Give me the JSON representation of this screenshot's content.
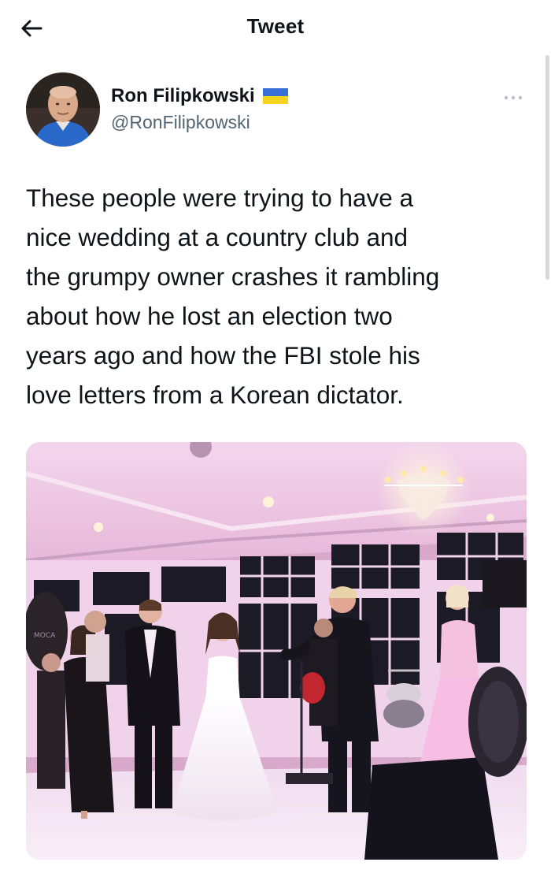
{
  "header": {
    "title": "Tweet",
    "back_icon": "arrow-left-icon"
  },
  "author": {
    "display_name": "Ron Filipkowski",
    "handle": "@RonFilipkowski",
    "badge_icon": "ukraine-flag-icon",
    "more_icon": "more-horizontal-icon"
  },
  "tweet": {
    "text": "These people were trying to have a\nnice wedding at a country club and\nthe grumpy owner crashes it rambling\nabout how he lost an election two\nyears ago and how the FBI stole his\nlove letters from a Korean dictator."
  },
  "media": {
    "sign_text": "MOCA"
  },
  "colors": {
    "text_primary": "#0f1419",
    "text_secondary": "#536471",
    "flag_blue": "#3a6fd8",
    "flag_yellow": "#f5d21d"
  }
}
